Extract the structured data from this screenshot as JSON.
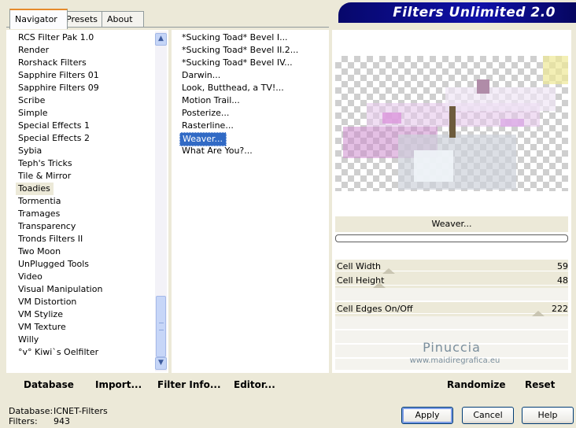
{
  "tabs": [
    {
      "label": "Navigator",
      "active": true
    },
    {
      "label": "Presets",
      "active": false
    },
    {
      "label": "About",
      "active": false
    }
  ],
  "banner": {
    "title": "Filters Unlimited 2.0"
  },
  "categories": [
    "RCS Filter Pak 1.0",
    "Render",
    "Rorshack Filters",
    "Sapphire Filters 01",
    "Sapphire Filters 09",
    "Scribe",
    "Simple",
    "Special Effects 1",
    "Special Effects 2",
    "Sybia",
    "Teph's Tricks",
    "Tile & Mirror",
    "Toadies",
    "Tormentia",
    "Tramages",
    "Transparency",
    "Tronds Filters II",
    "Two Moon",
    "UnPlugged Tools",
    "Video",
    "Visual Manipulation",
    "VM Distortion",
    "VM Stylize",
    "VM Texture",
    "Willy",
    "°v° Kiwi`s Oelfilter"
  ],
  "selected_category": "Toadies",
  "filters": [
    "*Sucking Toad*  Bevel I...",
    "*Sucking Toad*  Bevel II.2...",
    "*Sucking Toad*  Bevel IV...",
    "Darwin...",
    "Look, Butthead, a TV!...",
    "Motion Trail...",
    "Posterize...",
    "Rasterline...",
    "Weaver...",
    "What Are You?..."
  ],
  "selected_filter": "Weaver...",
  "filter_name": "Weaver...",
  "progress": 0,
  "controls": [
    {
      "label": "Cell Width",
      "value": "59",
      "level": 0.23
    },
    {
      "label": "Cell Height",
      "value": "48",
      "level": 0.19
    },
    {
      "label": "Cell Edges On/Off",
      "value": "222",
      "level": 0.87
    }
  ],
  "watermark": {
    "name": "Pinuccia",
    "url": "www.maidiregrafica.eu"
  },
  "bottom_links": {
    "database": "Database",
    "import": "Import...",
    "filter_info": "Filter Info...",
    "editor": "Editor...",
    "randomize": "Randomize",
    "reset": "Reset"
  },
  "status": {
    "database_label": "Database:",
    "database_value": "ICNET-Filters",
    "filters_label": "Filters:",
    "filters_value": "943"
  },
  "buttons": {
    "apply": "Apply",
    "cancel": "Cancel",
    "help": "Help"
  }
}
